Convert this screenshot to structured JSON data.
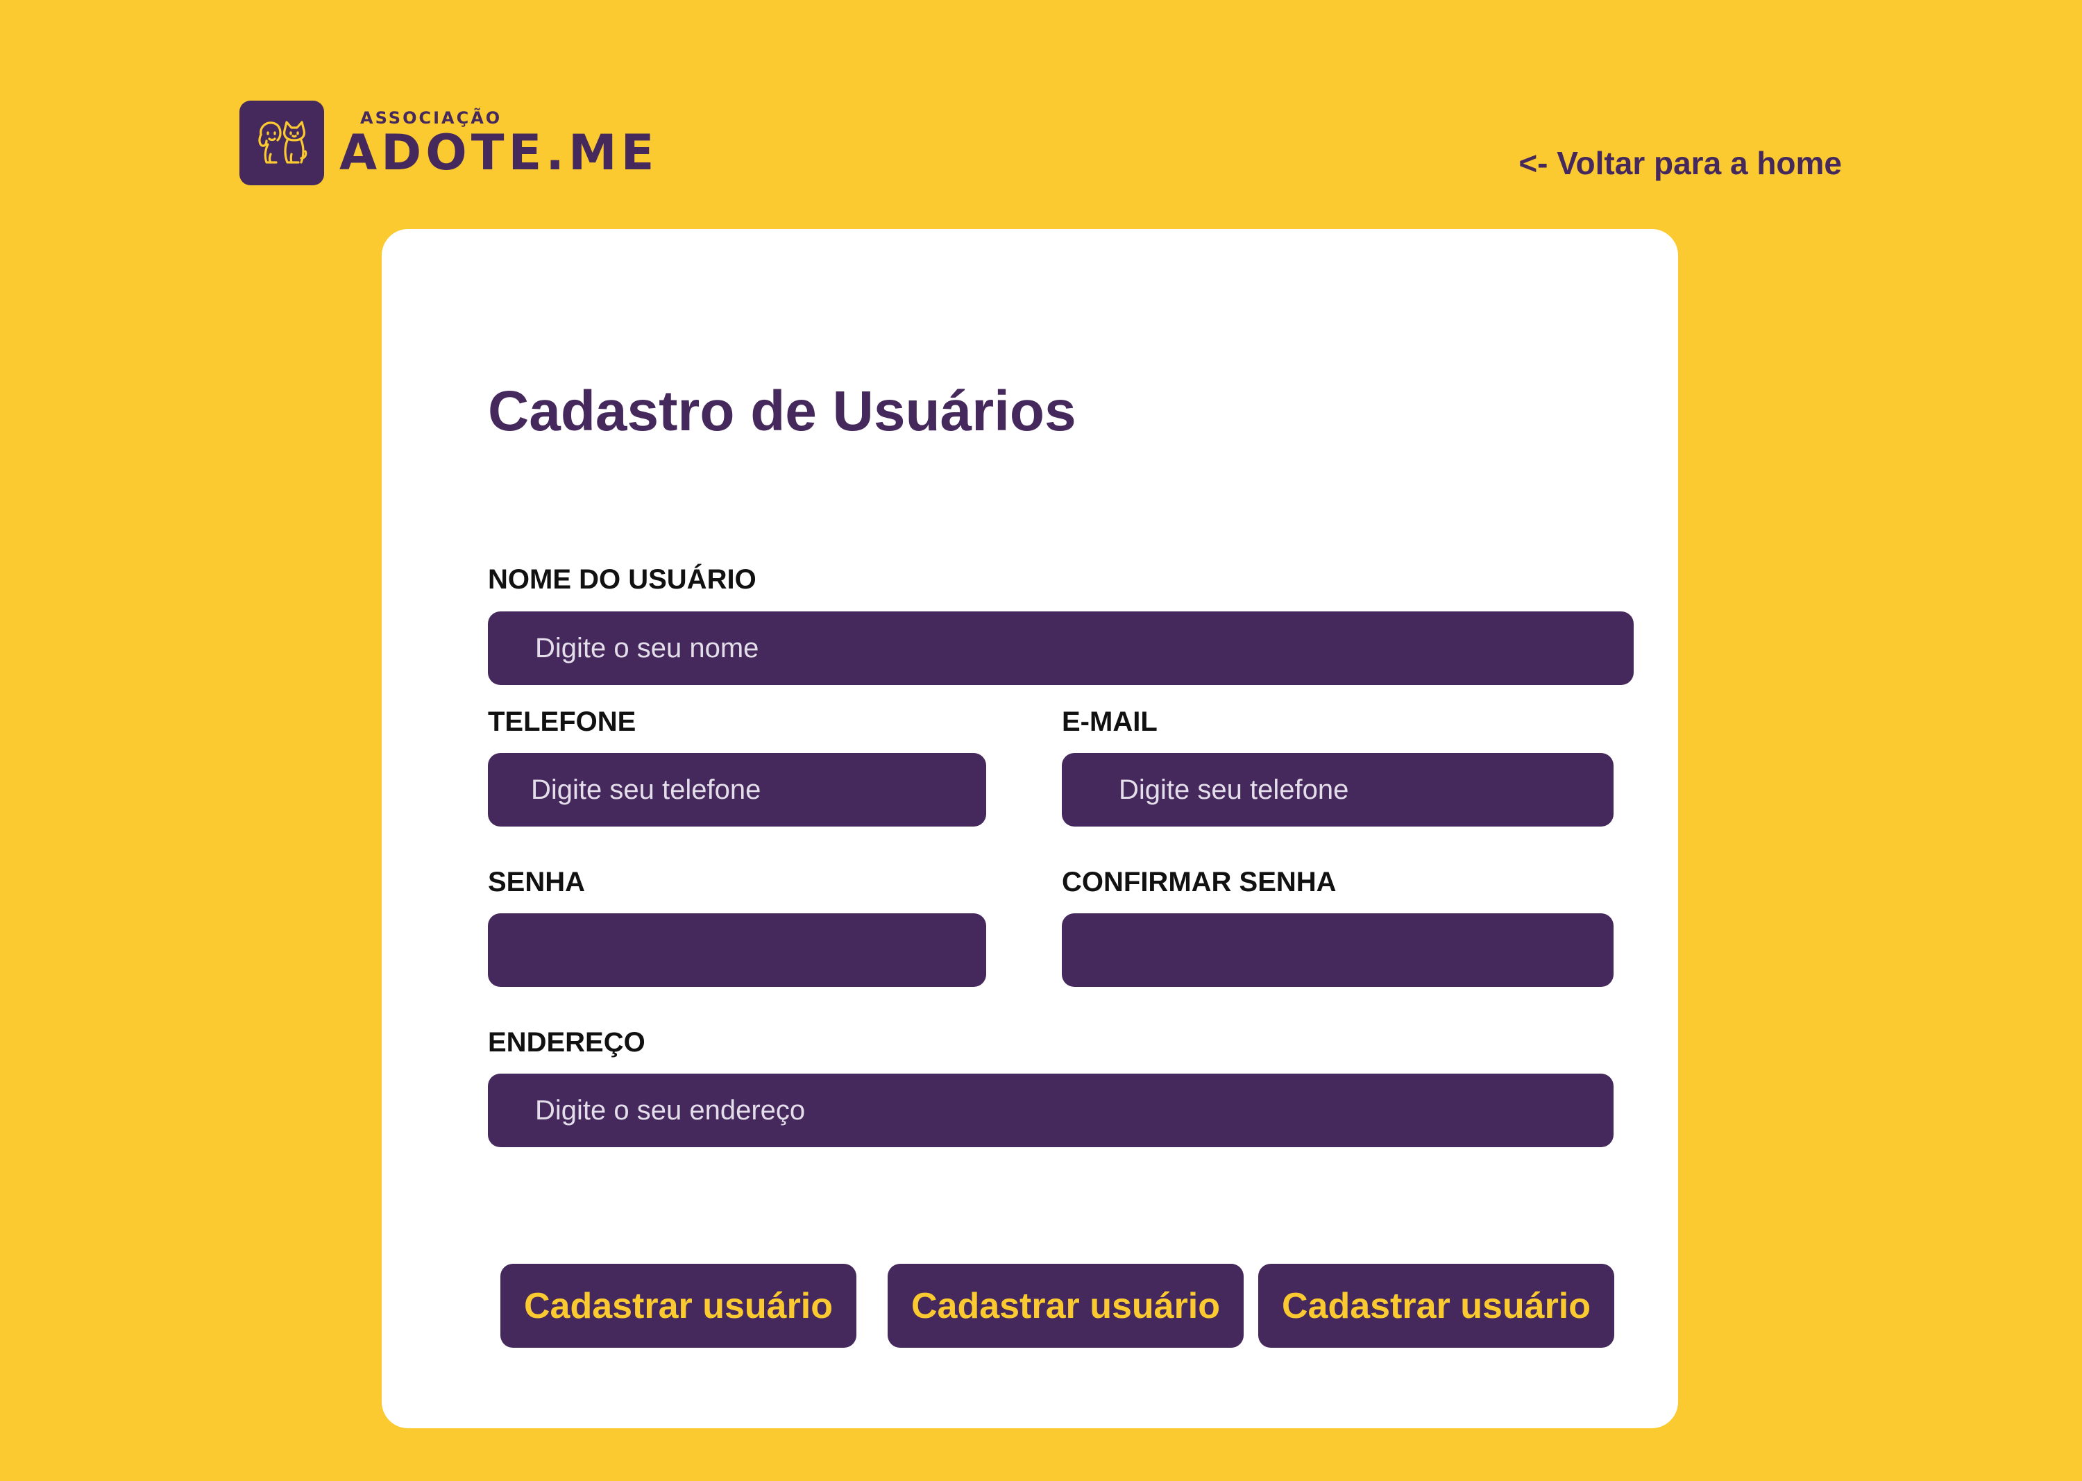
{
  "logo": {
    "top_text": "ASSOCIAÇÃO",
    "main_text": "ADOTE.ME",
    "icon": "dog-and-cat-icon"
  },
  "nav": {
    "back_label": "<- Voltar para a home"
  },
  "form": {
    "title": "Cadastro de Usuários",
    "fields": {
      "name": {
        "label": "NOME DO USUÁRIO",
        "placeholder": "Digite o seu nome",
        "value": ""
      },
      "phone": {
        "label": "TELEFONE",
        "placeholder": "Digite seu telefone",
        "value": ""
      },
      "email": {
        "label": "E-MAIL",
        "placeholder": "Digite seu telefone",
        "value": ""
      },
      "password": {
        "label": "SENHA",
        "placeholder": "",
        "value": ""
      },
      "confirm_password": {
        "label": "CONFIRMAR SENHA",
        "placeholder": "",
        "value": ""
      },
      "address": {
        "label": "ENDEREÇO",
        "placeholder": "Digite o seu endereço",
        "value": ""
      }
    },
    "buttons": [
      {
        "label": "Cadastrar usuário"
      },
      {
        "label": "Cadastrar usuário"
      },
      {
        "label": "Cadastrar usuário"
      }
    ]
  },
  "colors": {
    "background": "#FBCA31",
    "primary": "#45295C",
    "card": "#FFFFFF",
    "button_text": "#FBCA31"
  }
}
